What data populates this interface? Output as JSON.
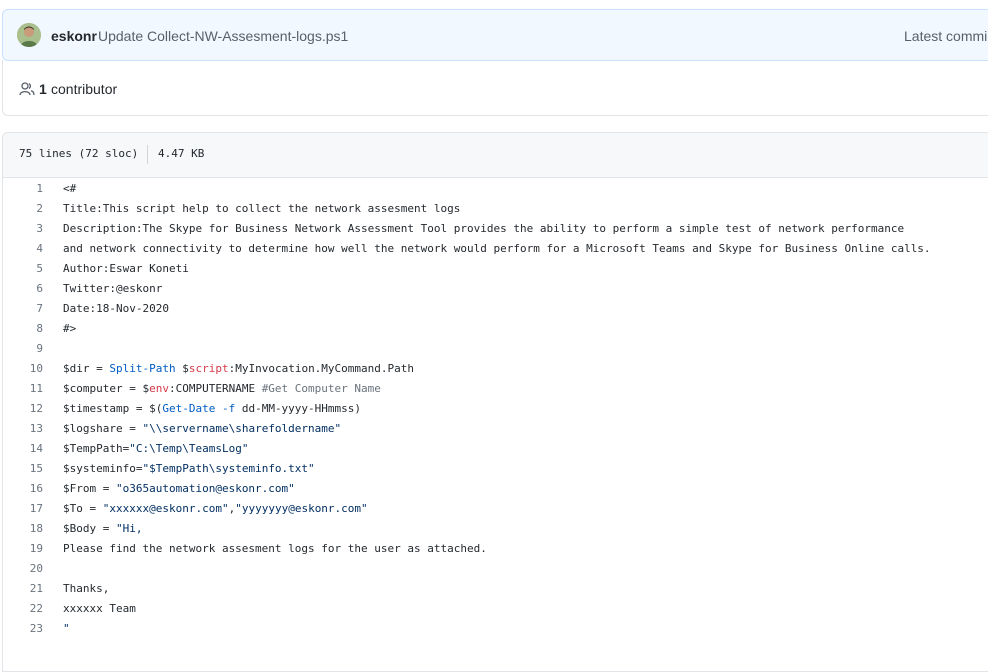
{
  "commit": {
    "author": "eskonr",
    "message": "Update Collect-NW-Assesment-logs.ps1",
    "latest_label": "Latest commi"
  },
  "contributors": {
    "count": "1",
    "label": "contributor"
  },
  "file_info": {
    "lines": "75 lines (72 sloc)",
    "size": "4.47 KB"
  },
  "code": {
    "line_numbers": [
      "1",
      "2",
      "3",
      "4",
      "5",
      "6",
      "7",
      "8",
      "9",
      "10",
      "11",
      "12",
      "13",
      "14",
      "15",
      "16",
      "17",
      "18",
      "19",
      "20",
      "21",
      "22",
      "23"
    ],
    "lines": [
      "<#",
      "Title:This script help to collect the network assesment logs",
      "Description:The Skype for Business Network Assessment Tool provides the ability to perform a simple test of network performance",
      "and network connectivity to determine how well the network would perform for a Microsoft Teams and Skype for Business Online calls.",
      "Author:Eswar Koneti",
      "Twitter:@eskonr",
      "Date:18-Nov-2020",
      "#>",
      "",
      "$dir = Split-Path $script:MyInvocation.MyCommand.Path",
      "$computer = $env:COMPUTERNAME #Get Computer Name",
      "$timestamp = $(Get-Date -f dd-MM-yyyy-HHmmss)",
      "$logshare = \"\\\\servername\\sharefoldername\"",
      "$TempPath=\"C:\\Temp\\TeamsLog\"",
      "$systeminfo=\"$TempPath\\systeminfo.txt\"",
      "$From = \"o365automation@eskonr.com\"",
      "$To = \"xxxxxx@eskonr.com\",\"yyyyyyy@eskonr.com\"",
      "$Body = \"Hi,",
      "Please find the network assesment logs for the user as attached.",
      "",
      "Thanks,",
      "xxxxxx Team",
      "\""
    ]
  },
  "colors": {
    "keyword": "#005cc5",
    "string": "#032f62",
    "scope": "#d73a49",
    "comment": "#6a737d"
  }
}
